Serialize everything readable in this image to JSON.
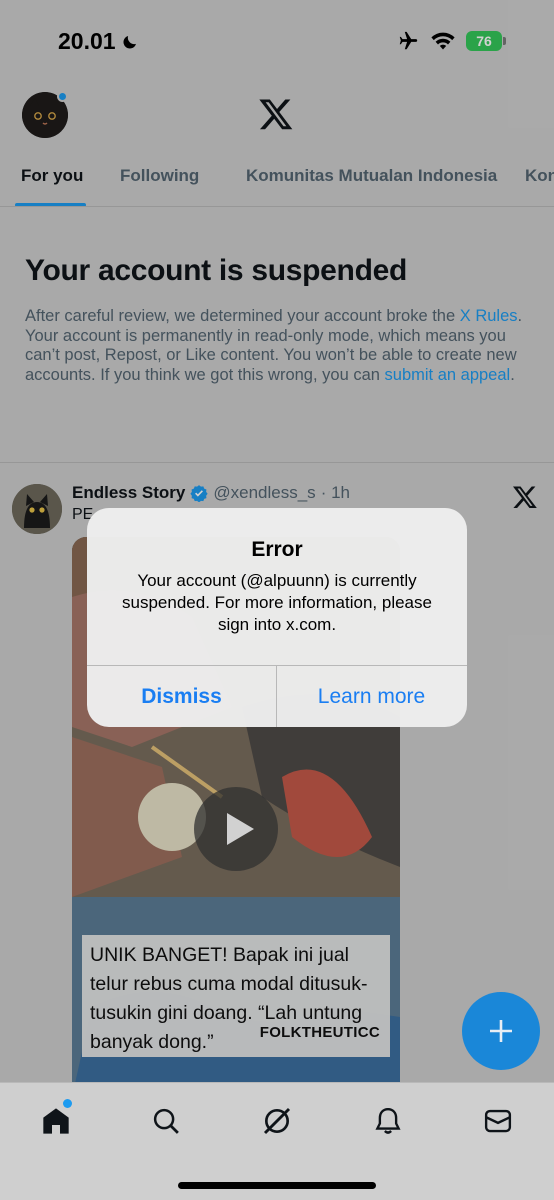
{
  "status_bar": {
    "time": "20.01",
    "battery": "76",
    "icons": [
      "moon-icon",
      "airplane-icon",
      "wifi-icon",
      "battery-icon"
    ]
  },
  "header": {
    "logo": "X"
  },
  "tabs": [
    {
      "label": "For you",
      "active": true
    },
    {
      "label": "Following",
      "active": false
    },
    {
      "label": "Komunitas Mutualan Indonesia",
      "active": false
    },
    {
      "label": "Kon",
      "active": false
    }
  ],
  "notice": {
    "title": "Your account is suspended",
    "body_1": "After careful review, we determined your account broke the ",
    "link_rules": "X Rules",
    "body_2": ". Your account is permanently in read-only mode, which means you can’t post, Repost, or Like content. You won’t be able to create new accounts. If you think we got this wrong, you can ",
    "link_appeal": "submit an appeal",
    "body_3": "."
  },
  "post": {
    "name": "Endless Story",
    "handle": "@xendless_s",
    "time": "· 1h",
    "text": "PE",
    "caption": "UNIK BANGET! Bapak ini jual telur rebus cuma modal ditusuk-tusukin gini doang. “Lah untung banyak dong.”",
    "caption_brand": "FOLKTHEUTICC"
  },
  "alert": {
    "title": "Error",
    "message": "Your account (@alpuunn) is currently suspended. For more information, please sign into x.com.",
    "dismiss": "Dismiss",
    "learn_more": "Learn more"
  },
  "bottom_nav": [
    "home-icon",
    "search-icon",
    "grok-icon",
    "notifications-icon",
    "messages-icon"
  ],
  "colors": {
    "accent": "#1d9bf0",
    "alert_button": "#1a7ef2",
    "battery": "#34c759"
  }
}
